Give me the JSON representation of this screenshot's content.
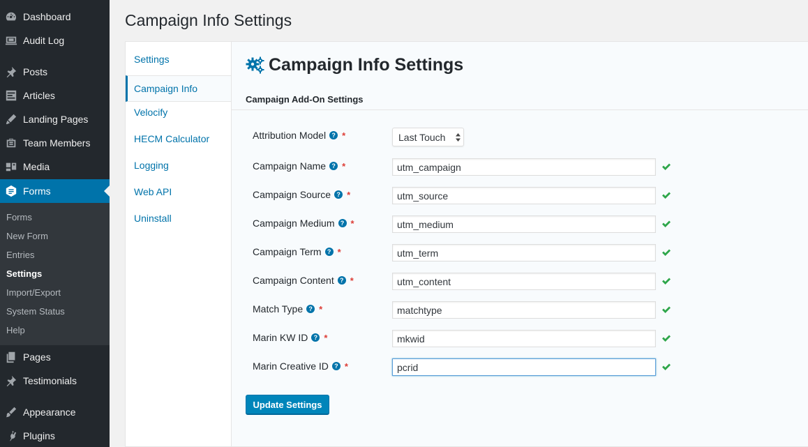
{
  "sidebar": {
    "items": [
      {
        "label": "Dashboard",
        "icon": "dashboard-icon"
      },
      {
        "label": "Audit Log",
        "icon": "audit-log-icon"
      },
      {
        "label": "Posts",
        "icon": "pin-icon"
      },
      {
        "label": "Articles",
        "icon": "articles-icon"
      },
      {
        "label": "Landing Pages",
        "icon": "tools-icon"
      },
      {
        "label": "Team Members",
        "icon": "team-icon"
      },
      {
        "label": "Media",
        "icon": "media-icon"
      },
      {
        "label": "Forms",
        "icon": "forms-icon"
      }
    ],
    "submenu": [
      "Forms",
      "New Form",
      "Entries",
      "Settings",
      "Import/Export",
      "System Status",
      "Help"
    ],
    "bottom_items": [
      {
        "label": "Pages",
        "icon": "pages-icon"
      },
      {
        "label": "Testimonials",
        "icon": "pin-icon"
      },
      {
        "label": "Appearance",
        "icon": "appearance-icon"
      },
      {
        "label": "Plugins",
        "icon": "plugins-icon"
      }
    ]
  },
  "page": {
    "title": "Campaign Info Settings"
  },
  "tabs": [
    "Settings",
    "Campaign Info",
    "Velocify",
    "HECM Calculator",
    "Logging",
    "Web API",
    "Uninstall"
  ],
  "content": {
    "title": "Campaign Info Settings",
    "section_title": "Campaign Add-On Settings",
    "attribution": {
      "label": "Attribution Model",
      "value": "Last Touch"
    },
    "fields": [
      {
        "label": "Campaign Name",
        "value": "utm_campaign"
      },
      {
        "label": "Campaign Source",
        "value": "utm_source"
      },
      {
        "label": "Campaign Medium",
        "value": "utm_medium"
      },
      {
        "label": "Campaign Term",
        "value": "utm_term"
      },
      {
        "label": "Campaign Content",
        "value": "utm_content"
      },
      {
        "label": "Match Type",
        "value": "matchtype"
      },
      {
        "label": "Marin KW ID",
        "value": "mkwid"
      },
      {
        "label": "Marin Creative ID",
        "value": "pcrid"
      }
    ],
    "help_glyph": "?",
    "required_marker": "*",
    "update_button": "Update Settings"
  },
  "colors": {
    "accent": "#0073aa",
    "sidebar_bg": "#23282d",
    "check": "#2ea64a",
    "required": "#dd3d36"
  }
}
